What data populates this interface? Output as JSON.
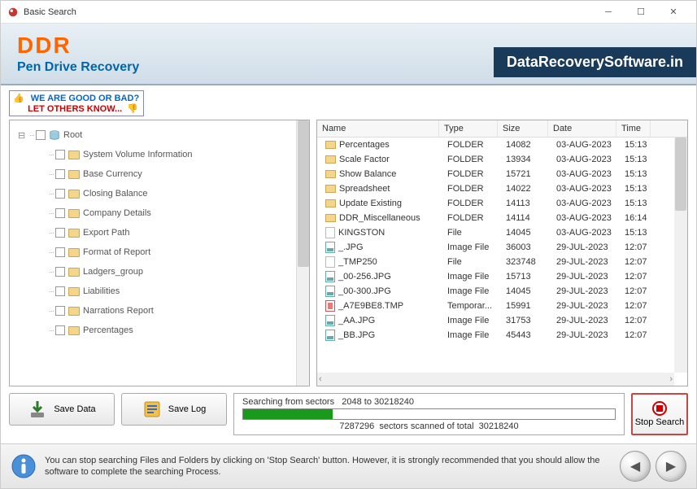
{
  "window": {
    "title": "Basic Search"
  },
  "banner": {
    "brand": "DDR",
    "subtitle": "Pen Drive Recovery",
    "website": "DataRecoverySoftware.in"
  },
  "promo": {
    "line1": "WE ARE GOOD OR BAD?",
    "line2": "LET OTHERS KNOW..."
  },
  "tree": {
    "root": "Root",
    "children": [
      "System Volume Information",
      "Base Currency",
      "Closing Balance",
      "Company Details",
      "Export Path",
      "Format of Report",
      "Ladgers_group",
      "Liabilities",
      "Narrations Report",
      "Percentages"
    ]
  },
  "list": {
    "headers": {
      "name": "Name",
      "type": "Type",
      "size": "Size",
      "date": "Date",
      "time": "Time"
    },
    "rows": [
      {
        "icon": "folder",
        "name": "Percentages",
        "type": "FOLDER",
        "size": "14082",
        "date": "03-AUG-2023",
        "time": "15:13"
      },
      {
        "icon": "folder",
        "name": "Scale Factor",
        "type": "FOLDER",
        "size": "13934",
        "date": "03-AUG-2023",
        "time": "15:13"
      },
      {
        "icon": "folder",
        "name": "Show Balance",
        "type": "FOLDER",
        "size": "15721",
        "date": "03-AUG-2023",
        "time": "15:13"
      },
      {
        "icon": "folder",
        "name": "Spreadsheet",
        "type": "FOLDER",
        "size": "14022",
        "date": "03-AUG-2023",
        "time": "15:13"
      },
      {
        "icon": "folder",
        "name": "Update Existing",
        "type": "FOLDER",
        "size": "14113",
        "date": "03-AUG-2023",
        "time": "15:13"
      },
      {
        "icon": "folder",
        "name": "DDR_Miscellaneous",
        "type": "FOLDER",
        "size": "14114",
        "date": "03-AUG-2023",
        "time": "16:14"
      },
      {
        "icon": "doc",
        "name": "KINGSTON",
        "type": "File",
        "size": "14045",
        "date": "03-AUG-2023",
        "time": "15:13"
      },
      {
        "icon": "img",
        "name": "_.JPG",
        "type": "Image File",
        "size": "36003",
        "date": "29-JUL-2023",
        "time": "12:07"
      },
      {
        "icon": "doc",
        "name": "_TMP250",
        "type": "File",
        "size": "323748",
        "date": "29-JUL-2023",
        "time": "12:07"
      },
      {
        "icon": "img",
        "name": "_00-256.JPG",
        "type": "Image File",
        "size": "15713",
        "date": "29-JUL-2023",
        "time": "12:07"
      },
      {
        "icon": "img",
        "name": "_00-300.JPG",
        "type": "Image File",
        "size": "14045",
        "date": "29-JUL-2023",
        "time": "12:07"
      },
      {
        "icon": "tmp",
        "name": "_A7E9BE8.TMP",
        "type": "Temporar...",
        "size": "15991",
        "date": "29-JUL-2023",
        "time": "12:07"
      },
      {
        "icon": "img",
        "name": "_AA.JPG",
        "type": "Image File",
        "size": "31753",
        "date": "29-JUL-2023",
        "time": "12:07"
      },
      {
        "icon": "img",
        "name": "_BB.JPG",
        "type": "Image File",
        "size": "45443",
        "date": "29-JUL-2023",
        "time": "12:07"
      }
    ]
  },
  "buttons": {
    "save_data": "Save Data",
    "save_log": "Save Log",
    "stop_search": "Stop Search"
  },
  "progress": {
    "label_prefix": "Searching from sectors",
    "range": "2048 to 30218240",
    "scanned": "7287296",
    "total": "30218240",
    "mid": "sectors scanned of total"
  },
  "footer": {
    "tip": "You can stop searching Files and Folders by clicking on 'Stop Search' button. However, it is strongly recommended that you should allow the software to complete the searching Process."
  }
}
